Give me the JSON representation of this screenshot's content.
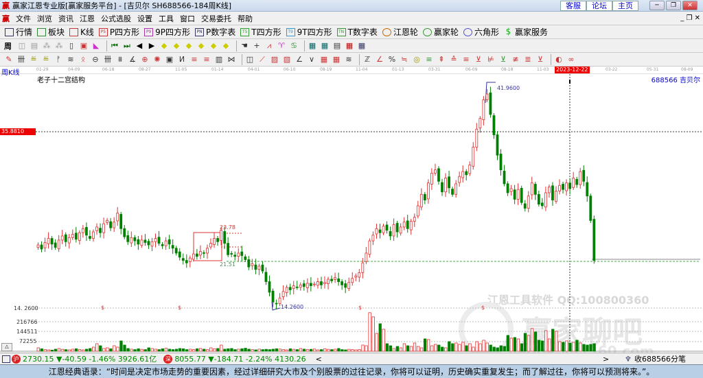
{
  "window": {
    "title": "赢家江恩专业版[赢家服务平台] - [吉贝尔  SH688566-184周K线]",
    "links": [
      "客服",
      "论坛",
      "主页"
    ]
  },
  "menu": [
    "文件",
    "浏览",
    "资讯",
    "江恩",
    "公式选股",
    "设置",
    "工具",
    "窗口",
    "交易委托",
    "帮助"
  ],
  "toolbar1": [
    {
      "icon": "quote-grid-icon",
      "label": "行情"
    },
    {
      "icon": "sector-icon",
      "label": "板块"
    },
    {
      "icon": "kline-icon",
      "label": "K线"
    },
    {
      "icon": "P5",
      "label": "P四方形"
    },
    {
      "icon": "P9",
      "label": "9P四方形"
    },
    {
      "icon": "PN",
      "label": "P数字表"
    },
    {
      "icon": "T5",
      "label": "T四方形"
    },
    {
      "icon": "T9",
      "label": "9T四方形"
    },
    {
      "icon": "TN",
      "label": "T数字表"
    },
    {
      "icon": "gann-wheel-icon",
      "label": "江恩轮"
    },
    {
      "icon": "winner-wheel-icon",
      "label": "赢家轮"
    },
    {
      "icon": "hexagon-icon",
      "label": "六角形"
    },
    {
      "icon": "dollar-icon",
      "label": "赢家服务"
    }
  ],
  "toolbar2": {
    "period": "周"
  },
  "chart_header": {
    "period_label": "周K线",
    "indicator": "老子十二宫结构",
    "symbol": "688566  吉贝尔"
  },
  "date_axis": [
    "01-29",
    "04-09",
    "06-18",
    "08-27",
    "11-05",
    "01-14",
    "04-01",
    "06-10",
    "08-19",
    "11-04",
    "01-13",
    "03-31",
    "06-09",
    "08-18",
    "11-03",
    "03-22",
    "05-31",
    "08-09"
  ],
  "cursor_date": "2023-12-22",
  "labels": {
    "cursor_price": "35.8810",
    "high": "41.9600",
    "low": "14.2600",
    "low_axis": "14. 2600",
    "box_high": "23.78",
    "box_low": "21.51",
    "dollar": "$"
  },
  "volume_axis": [
    "216766",
    "144511",
    "72255"
  ],
  "watermark": {
    "line1": "江恩工具软件  QQ:100800360",
    "line2": "赢家聊吧",
    "line3": "liaoba.yjcf360.com"
  },
  "status": {
    "sh": "2730.15 ▼-40.59 -1.46% 3926.61亿",
    "sz": "8055.77 ▼-184.71 -2.24% 4130.26",
    "right": "收688566分笔",
    "sh_badge": "沪",
    "sz_badge": "深"
  },
  "quote": "江恩经典语录：“时间是决定市场走势的重要因素，经过详细研究大市及个别股票的过往记录，你将可以证明，历史确实重复发生；而了解过往，你将可以预测将来。”。",
  "colors": {
    "up": "#e03030",
    "down": "#008000",
    "accent": "#0000cc"
  },
  "chart_data": {
    "type": "candlestick",
    "title": "吉贝尔 SH688566 周K线",
    "price_range": [
      14.26,
      41.96
    ],
    "closes": [
      22.0,
      21.5,
      22.3,
      22.8,
      22.1,
      21.7,
      22.6,
      23.1,
      22.4,
      22.9,
      23.3,
      22.7,
      23.5,
      24.0,
      23.2,
      22.8,
      23.6,
      24.2,
      23.5,
      24.6,
      25.0,
      24.1,
      24.8,
      25.9,
      24.0,
      23.0,
      22.4,
      22.9,
      22.5,
      22.1,
      22.6,
      22.3,
      22.0,
      22.4,
      22.8,
      22.2,
      21.9,
      22.5,
      22.1,
      21.6,
      21.0,
      20.5,
      20.1,
      19.8,
      20.4,
      20.9,
      20.6,
      21.2,
      21.0,
      21.6,
      22.2,
      22.8,
      22.4,
      23.8,
      22.2,
      20.8,
      20.9,
      20.6,
      21.0,
      20.7,
      20.2,
      19.3,
      19.7,
      19.0,
      19.4,
      18.8,
      17.5,
      16.2,
      15.0,
      14.8,
      15.5,
      16.3,
      16.8,
      16.5,
      17.0,
      16.8,
      17.1,
      16.9,
      17.3,
      17.0,
      17.2,
      17.5,
      17.1,
      17.4,
      17.8,
      17.6,
      18.0,
      17.5,
      17.1,
      16.8,
      17.4,
      17.9,
      18.2,
      18.6,
      19.8,
      21.0,
      22.5,
      23.2,
      24.0,
      23.5,
      24.3,
      23.8,
      23.1,
      24.5,
      23.6,
      24.2,
      24.8,
      24.0,
      24.9,
      25.4,
      26.8,
      28.2,
      27.5,
      29.6,
      30.8,
      31.2,
      29.8,
      28.5,
      30.2,
      29.0,
      28.2,
      29.5,
      30.4,
      31.0,
      30.6,
      31.8,
      34.0,
      36.2,
      37.5,
      39.8,
      40.5,
      38.0,
      35.5,
      33.0,
      31.2,
      29.5,
      28.4,
      28.9,
      27.6,
      28.8,
      27.2,
      26.5,
      28.0,
      29.6,
      28.2,
      27.0,
      26.8,
      28.4,
      29.1,
      27.5,
      28.6,
      29.3,
      28.8,
      29.6,
      28.9,
      30.2,
      29.4,
      31.0,
      29.8,
      28.0,
      25.0,
      20.1
    ],
    "volume_thousands": [
      25,
      18,
      12,
      10,
      8,
      15,
      20,
      14,
      12,
      10,
      15,
      18,
      12,
      10,
      15,
      20,
      30,
      55,
      40,
      20,
      25,
      18,
      40,
      30,
      75,
      45,
      20,
      15,
      12,
      18,
      14,
      12,
      25,
      20,
      15,
      12,
      18,
      22,
      15,
      12,
      15,
      20,
      18,
      12,
      15,
      12,
      18,
      20,
      15,
      12,
      25,
      18,
      20,
      45,
      15,
      18,
      20,
      12,
      15,
      18,
      22,
      15,
      12,
      10,
      15,
      12,
      14,
      12,
      15,
      18,
      16,
      12,
      10,
      18,
      14,
      12,
      20,
      15,
      12,
      14,
      16,
      10,
      12,
      18,
      14,
      12,
      15,
      20,
      12,
      10,
      14,
      12,
      10,
      12,
      45,
      40,
      280,
      250,
      130,
      200,
      160,
      55,
      40,
      20,
      35,
      25,
      55,
      40,
      35,
      60,
      35,
      25,
      90,
      85,
      40,
      50,
      45,
      30,
      25,
      70,
      55,
      60,
      50,
      65,
      40,
      55,
      30,
      70,
      55,
      80,
      60,
      45,
      30,
      25,
      40,
      35,
      115,
      95,
      100,
      90,
      55,
      130,
      115,
      165,
      140,
      80,
      75,
      150,
      90,
      160,
      145,
      70,
      65,
      75,
      60,
      65,
      80,
      60,
      50,
      45,
      50,
      55
    ]
  }
}
